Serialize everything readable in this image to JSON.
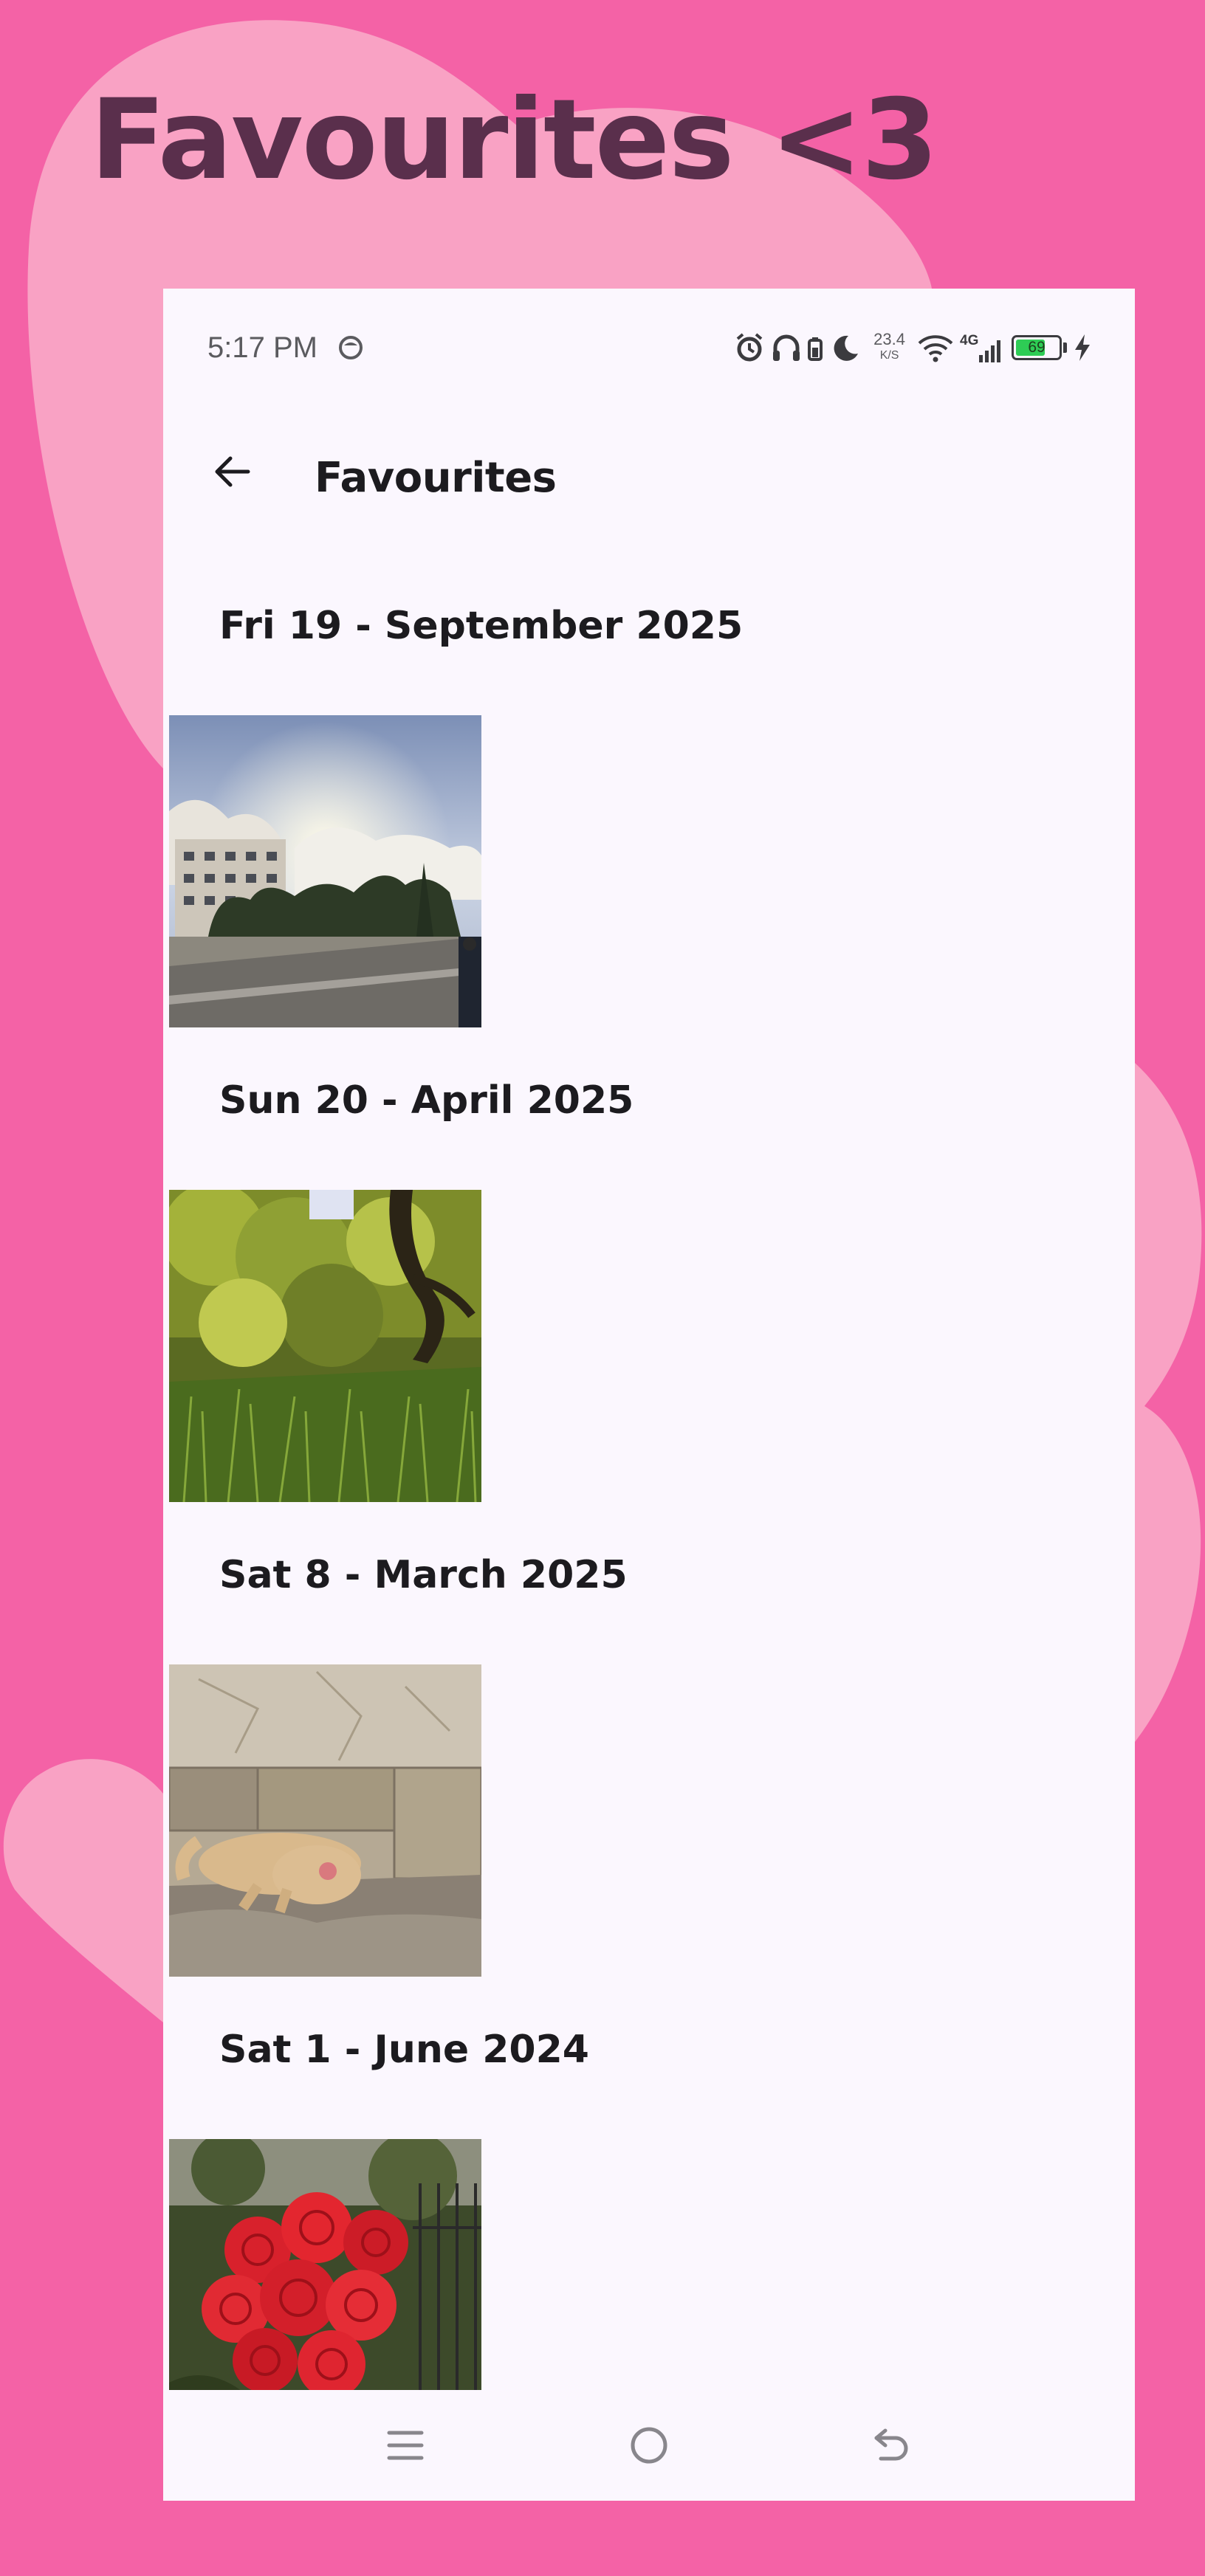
{
  "headline": "Favourites <3",
  "colors": {
    "background": "#f462a6",
    "decor": "#f9a2c4",
    "headline": "#5a2f4c",
    "screen": "#fbf7fe",
    "text": "#1c1b1f",
    "battery_fill": "#2ecc55"
  },
  "status_bar": {
    "time": "5:17 PM",
    "speed_value": "23.4",
    "speed_unit": "K/S",
    "network": "4G",
    "battery_level": "69",
    "icons": [
      "face-icon",
      "alarm-icon",
      "headphones-icon",
      "headphone-battery-icon",
      "moon-icon",
      "wifi-icon",
      "signal-icon",
      "battery-icon",
      "charging-bolt-icon"
    ]
  },
  "app_bar": {
    "back_icon": "arrow-back-icon",
    "title": "Favourites"
  },
  "groups": [
    {
      "date": "Fri 19 - September 2025",
      "photo": "sky-buildings-photo"
    },
    {
      "date": "Sun 20 - April 2025",
      "photo": "green-foliage-photo"
    },
    {
      "date": "Sat 8 - March 2025",
      "photo": "sleeping-cat-photo"
    },
    {
      "date": "Sat 1 - June 2024",
      "photo": "red-roses-photo"
    }
  ],
  "nav_bar": {
    "icons": [
      "menu-icon",
      "home-icon",
      "back-icon"
    ]
  }
}
